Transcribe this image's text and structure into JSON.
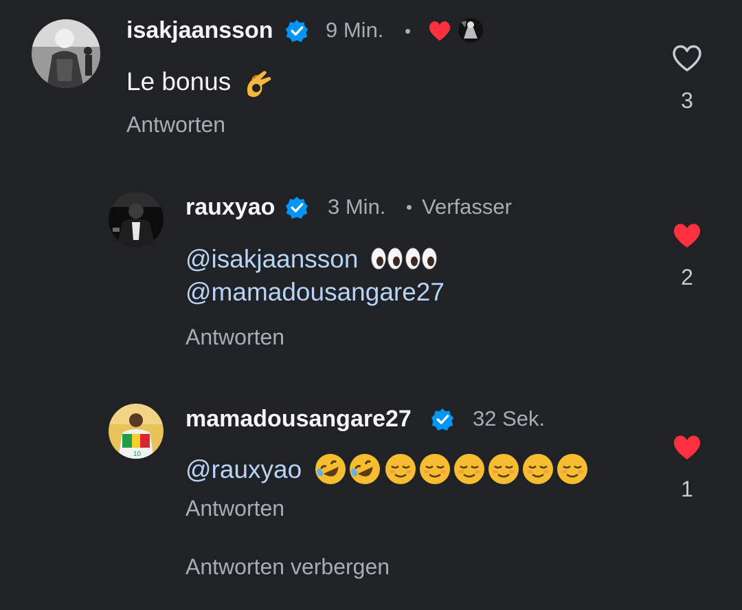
{
  "comments": [
    {
      "username": "isakjaansson",
      "time": "9 Min.",
      "text": "Le bonus",
      "reply_label": "Antworten",
      "likes": "3",
      "liked": false,
      "creator_liked": true
    },
    {
      "username": "rauxyao",
      "time": "3 Min.",
      "author_badge": "Verfasser",
      "mention_1": "@isakjaansson",
      "mention_2": "@mamadousangare27",
      "reply_label": "Antworten",
      "likes": "2",
      "liked": true
    },
    {
      "username": "mamadousangare27",
      "time": "32 Sek.",
      "mention": "@rauxyao",
      "reply_label": "Antworten",
      "likes": "1",
      "liked": true
    }
  ],
  "hide_replies_label": "Antworten verbergen",
  "colors": {
    "background": "#202226",
    "mention": "#b7d4f6",
    "like_red": "#ff3040",
    "verified_blue": "#0095f6"
  },
  "icons": [
    "verified-badge-icon",
    "heart-icon",
    "ok-hand-emoji",
    "eyes-emoji",
    "rofl-emoji",
    "relieved-emoji"
  ]
}
